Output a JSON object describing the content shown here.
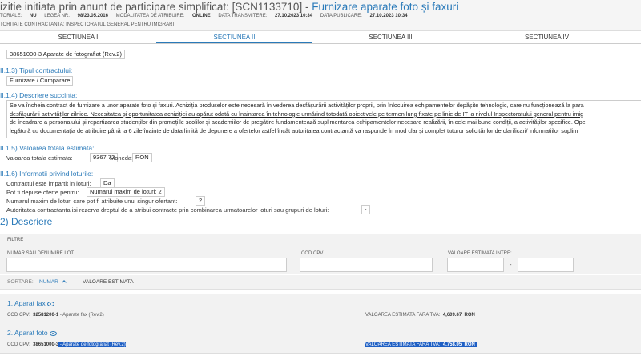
{
  "header": {
    "title_prefix": "izitie initiata prin anunt de participare simplificat: [SCN1133710] - ",
    "title_highlight": "Furnizare aparate foto și faxuri",
    "meta": [
      {
        "label": "TORIALE:",
        "value": "NU"
      },
      {
        "label": "LEGEA NR.",
        "value": "98/23.05.2016"
      },
      {
        "label": "MODALITATEA DE ATRIBUIRE:",
        "value": "ONLINE"
      },
      {
        "label": "DATA TRANSMITERE:",
        "value": "27.10.2023 10:34"
      },
      {
        "label": "DATA PUBLICARE:",
        "value": "27.10.2023 10:34"
      }
    ],
    "authority": "TORITATE CONTRACTANTA: INSPECTORATUL GENERAL PENTRU IMIGRARI"
  },
  "tabs": [
    "SECTIUNEA I",
    "SECTIUNEA II",
    "SECTIUNEA III",
    "SECTIUNEA IV"
  ],
  "cpv_main": "38651000-3 Aparate de fotografiat (Rev.2)",
  "contract_type": {
    "heading": "II.1.3) Tipul contractului:",
    "value": "Furnizare / Cumparare"
  },
  "description": {
    "heading": "II.1.4) Descriere succinta:",
    "lines": [
      "Se va încheia contract de furnizare a unor aparate foto și faxuri. Achiziția produselor este necesară în vederea desfășurării activităților proprii, prin înlocuirea echipamentelor depășite tehnologic, care nu funcționează la para",
      "desfășurării activităților zilnice. Necesitatea și oportunitatea achiziției au apărut odată cu înaintarea în tehnologie urmărind totodată obiectivele pe termen lung fixate pe linie de IT la nivelul Inspectoratului general pentru imig",
      "de încadrare a personalului și repartizarea studenților din promoțiile școlilor și academiilor de pregătire fundamentează suplimentarea echipamentelor necesare realizării, în cele mai bune condiții, a activităților specifice. Ope",
      "legătură cu documentația de atribuire până la 6 zile înainte de data limită de depunere a ofertelor astfel încât autoritatea contractantă va raspunde în mod clar și complet tuturor solicitărilor de clarificari/ informatiilor suplim"
    ]
  },
  "value": {
    "heading": "II.1.5) Valoarea totala estimata:",
    "label": "Valoarea totala estimata:",
    "amount": "9367.72",
    "currency_label": "Moneda:",
    "currency": "RON"
  },
  "lots_info": {
    "heading": "II.1.6) Informatii privind loturile:",
    "divided_label": "Contractul este impartit in loturi:",
    "divided_value": "Da",
    "offers_label": "Pot fi depuse oferte pentru:",
    "offers_value": "Numarul maxim de loturi: 2",
    "max_lots_label": "Numarul maxim de loturi care pot fi atribuite unui singur ofertant:",
    "max_lots_value": "2",
    "reserve_label": "Autoritatea contractanta isi rezerva dreptul de a atribui contracte prin combinarea urmatoarelor loturi sau grupuri de loturi:",
    "reserve_value": "-"
  },
  "section2_title": "2) Descriere",
  "filters": {
    "title": "FILTRE",
    "lot_label": "NUMAR SAU DENUMIRE LOT",
    "cpv_label": "COD CPV",
    "value_label": "VALOARE ESTIMATA INTRE:",
    "dash": "-"
  },
  "sort": {
    "label": "SORTARE:",
    "by_number": "NUMAR",
    "by_value": "VALOARE ESTIMATA"
  },
  "lots": [
    {
      "title": "1. Aparat fax",
      "cpv_label": "COD CPV:",
      "cpv_code": "32581200-1",
      "cpv_sep": " - ",
      "cpv_desc": "Aparate fax (Rev.2)",
      "value_label": "VALOAREA ESTIMATA FARA TVA:",
      "value": "4,609.67",
      "currency": "RON"
    },
    {
      "title": "2. Aparat foto",
      "cpv_label": "COD CPV:",
      "cpv_code": "38651000-3",
      "cpv_sep": " - ",
      "cpv_desc": "Aparate de fotografiat (Rev.2)",
      "value_label": "VALOAREA ESTIMATA FARA TVA:",
      "value": "4,758.05",
      "currency": "RON"
    }
  ],
  "colors": {
    "accent": "#2a7ab9",
    "selection": "#1e5fc4",
    "panel": "#f2f2f2"
  }
}
